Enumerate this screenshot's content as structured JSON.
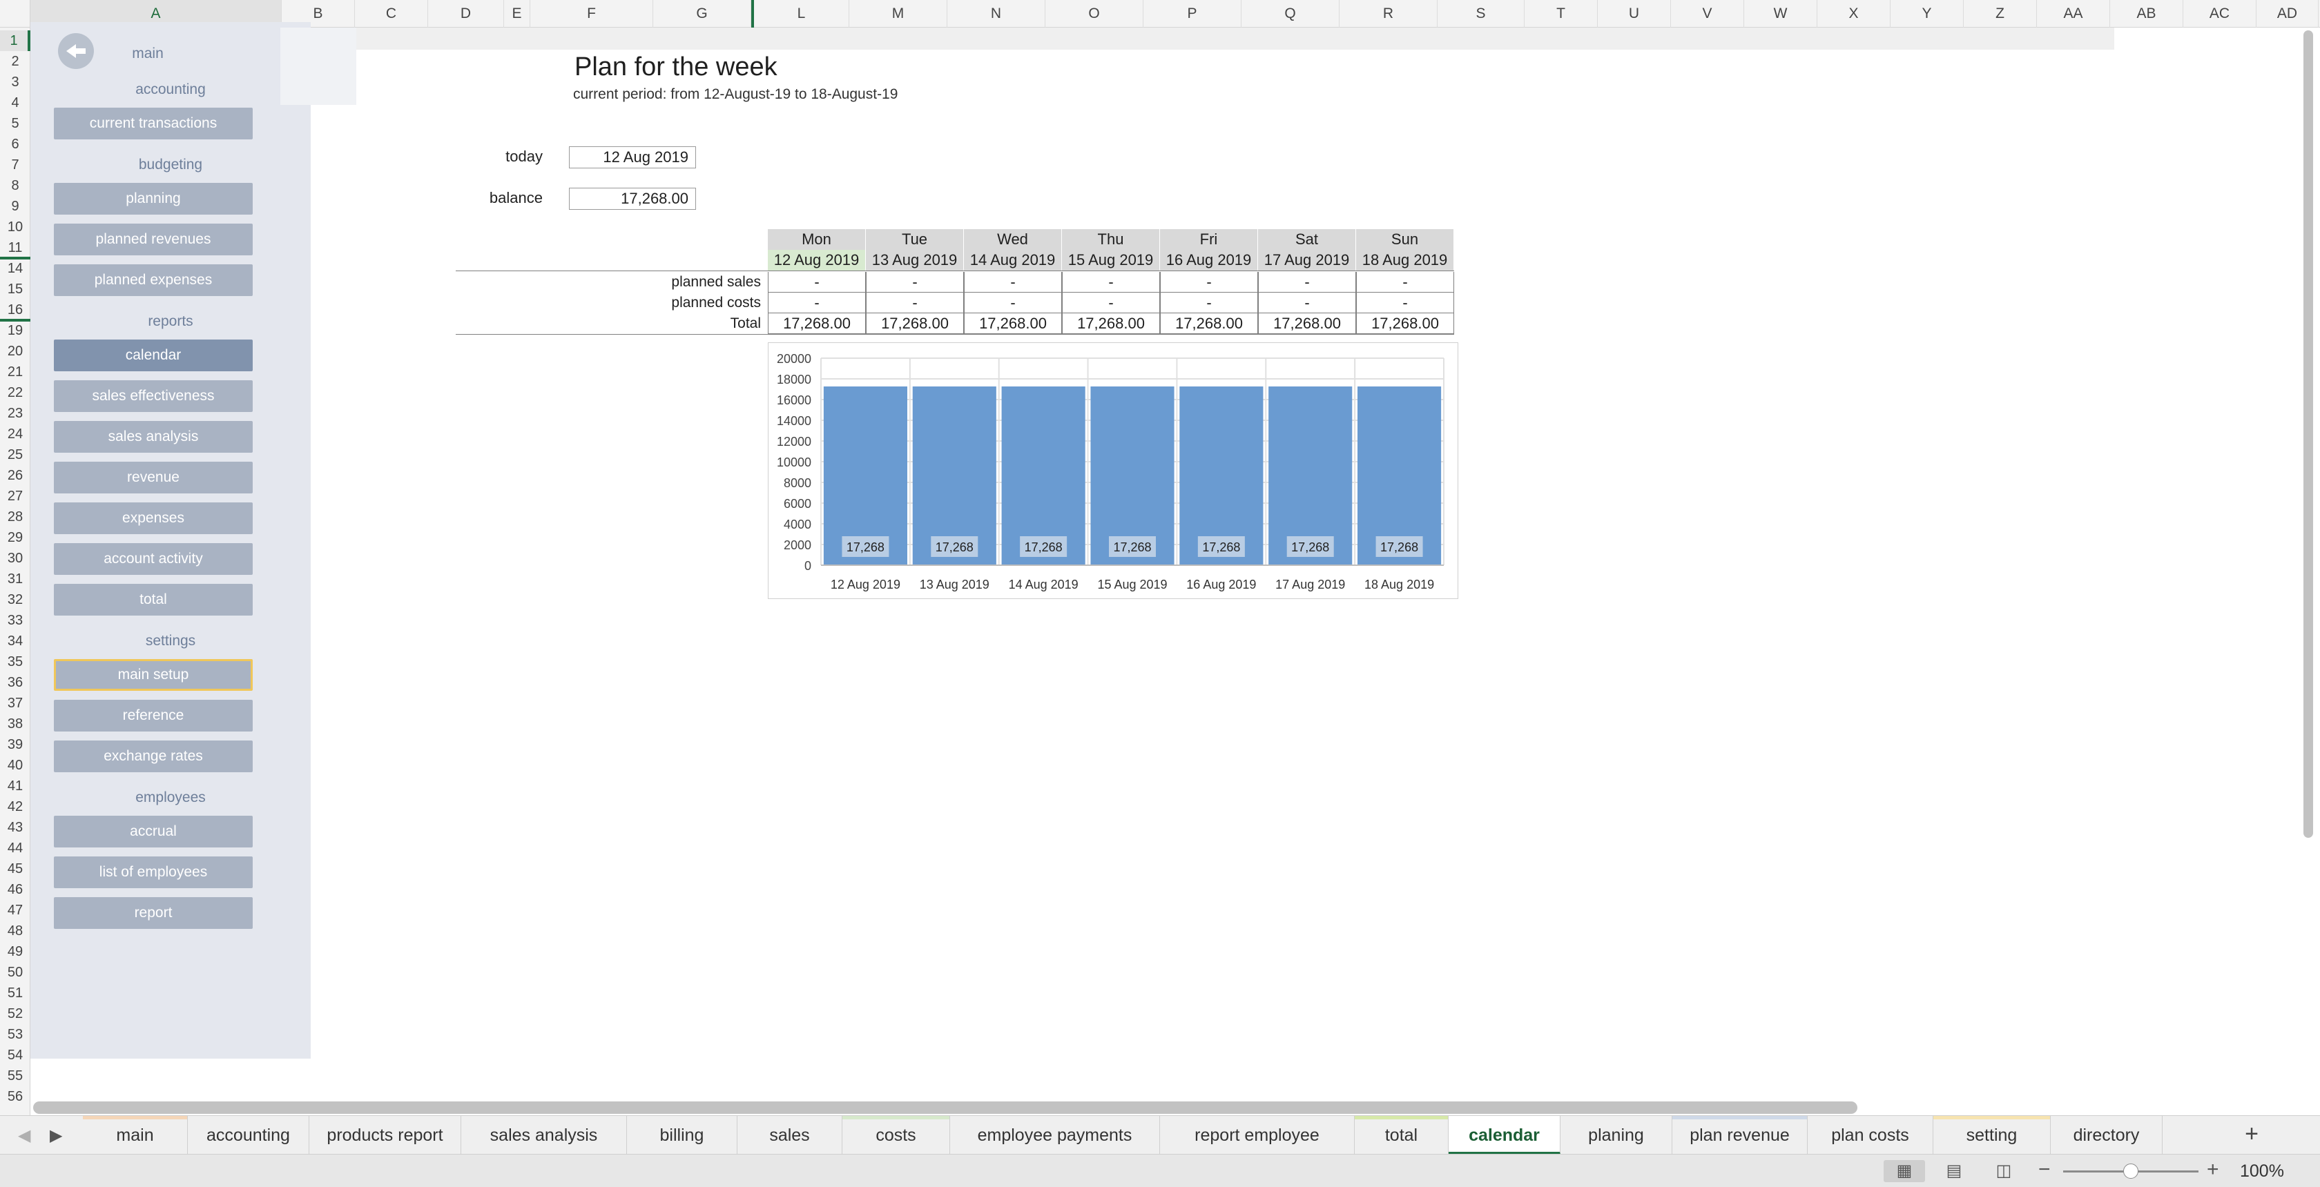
{
  "columns": [
    "A",
    "B",
    "C",
    "D",
    "E",
    "F",
    "G",
    "L",
    "M",
    "N",
    "O",
    "P",
    "Q",
    "R",
    "S",
    "T",
    "U",
    "V",
    "W",
    "X",
    "Y",
    "Z",
    "AA",
    "AB",
    "AC",
    "AD"
  ],
  "rows": [
    "1",
    "2",
    "3",
    "4",
    "5",
    "6",
    "7",
    "8",
    "9",
    "10",
    "11",
    "14",
    "15",
    "16",
    "19",
    "20",
    "21",
    "22",
    "23",
    "24",
    "25",
    "26",
    "27",
    "28",
    "29",
    "30",
    "31",
    "32",
    "33",
    "34",
    "35",
    "36",
    "37",
    "38",
    "39",
    "40",
    "41",
    "42",
    "43",
    "44",
    "45",
    "46",
    "47",
    "48",
    "49",
    "50",
    "51",
    "52",
    "53",
    "54",
    "55",
    "56"
  ],
  "sidebar": {
    "main_label": "main",
    "sections": [
      {
        "label": "accounting",
        "items": [
          "current transactions"
        ]
      },
      {
        "label": "budgeting",
        "items": [
          "planning",
          "planned revenues",
          "planned expenses"
        ]
      },
      {
        "label": "reports",
        "items": [
          "calendar",
          "sales effectiveness",
          "sales analysis",
          "revenue",
          "expenses",
          "account activity",
          "total"
        ]
      },
      {
        "label": "settings",
        "items": [
          "main setup",
          "reference",
          "exchange rates"
        ]
      },
      {
        "label": "employees",
        "items": [
          "accrual",
          "list of employees",
          "report"
        ]
      }
    ],
    "active_item": "calendar",
    "highlighted_item": "main setup"
  },
  "content": {
    "title": "Plan for the week",
    "subtitle": "current period: from 12-August-19 to 18-August-19",
    "today_label": "today",
    "today_value": "12 Aug 2019",
    "balance_label": "balance",
    "balance_value": "17,268.00"
  },
  "week_table": {
    "days": [
      "Mon",
      "Tue",
      "Wed",
      "Thu",
      "Fri",
      "Sat",
      "Sun"
    ],
    "dates": [
      "12 Aug 2019",
      "13 Aug 2019",
      "14 Aug 2019",
      "15 Aug 2019",
      "16 Aug 2019",
      "17 Aug 2019",
      "18 Aug 2019"
    ],
    "rows": [
      {
        "label": "planned sales",
        "values": [
          "-",
          "-",
          "-",
          "-",
          "-",
          "-",
          "-"
        ]
      },
      {
        "label": "planned costs",
        "values": [
          "-",
          "-",
          "-",
          "-",
          "-",
          "-",
          "-"
        ]
      },
      {
        "label": "Total",
        "values": [
          "17,268.00",
          "17,268.00",
          "17,268.00",
          "17,268.00",
          "17,268.00",
          "17,268.00",
          "17,268.00"
        ]
      }
    ]
  },
  "chart_data": {
    "type": "bar",
    "categories": [
      "12 Aug 2019",
      "13 Aug 2019",
      "14 Aug 2019",
      "15 Aug 2019",
      "16 Aug 2019",
      "17 Aug 2019",
      "18 Aug 2019"
    ],
    "values": [
      17268,
      17268,
      17268,
      17268,
      17268,
      17268,
      17268
    ],
    "data_labels": [
      "17,268",
      "17,268",
      "17,268",
      "17,268",
      "17,268",
      "17,268",
      "17,268"
    ],
    "yticks": [
      0,
      2000,
      4000,
      6000,
      8000,
      10000,
      12000,
      14000,
      16000,
      18000,
      20000
    ],
    "ylim": [
      0,
      20000
    ],
    "title": "",
    "xlabel": "",
    "ylabel": "",
    "grid": true,
    "bar_color": "#6a9bd1"
  },
  "sheet_tabs": [
    {
      "label": "main",
      "accent": "#f5d6b8"
    },
    {
      "label": "accounting",
      "accent": ""
    },
    {
      "label": "products report",
      "accent": ""
    },
    {
      "label": "sales analysis",
      "accent": ""
    },
    {
      "label": "billing",
      "accent": ""
    },
    {
      "label": "sales",
      "accent": ""
    },
    {
      "label": "costs",
      "accent": "#d7e9cc"
    },
    {
      "label": "employee payments",
      "accent": ""
    },
    {
      "label": "report employee",
      "accent": ""
    },
    {
      "label": "total",
      "accent": "#d7e9a9"
    },
    {
      "label": "calendar",
      "accent": ""
    },
    {
      "label": "planing",
      "accent": ""
    },
    {
      "label": "plan revenue",
      "accent": "#cfd9e8"
    },
    {
      "label": "plan costs",
      "accent": ""
    },
    {
      "label": "setting",
      "accent": "#f7e4b0"
    },
    {
      "label": "directory",
      "accent": ""
    }
  ],
  "active_tab": "calendar",
  "add_sheet_label": "+",
  "status": {
    "zoom": "100%",
    "zoom_fraction": 0.5
  }
}
